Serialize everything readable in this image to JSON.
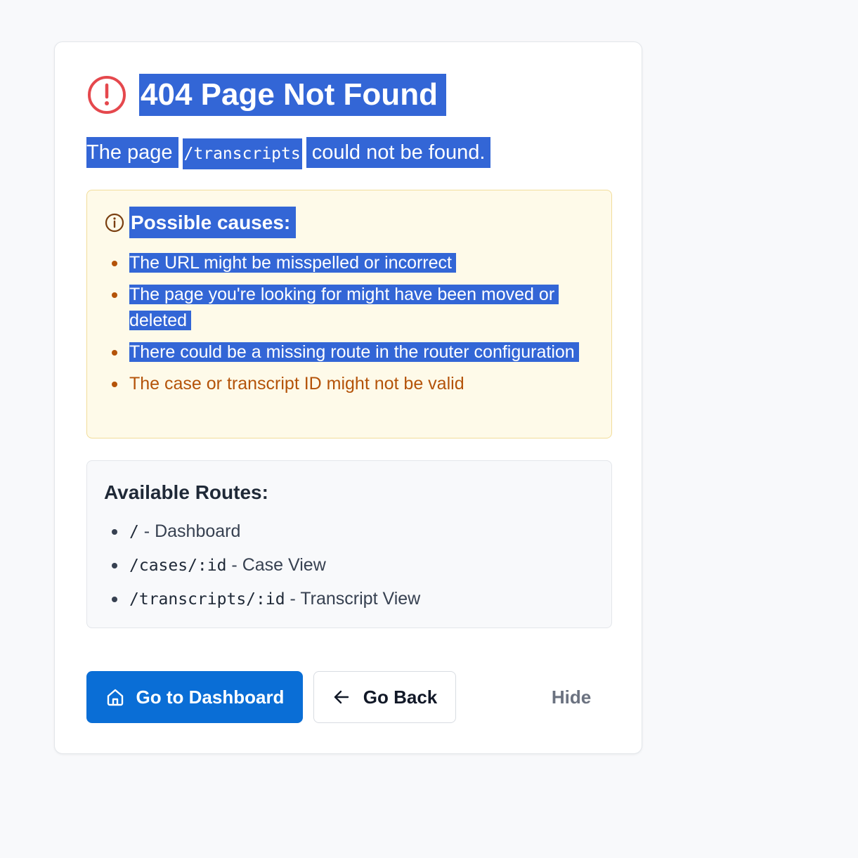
{
  "header": {
    "title": "404 Page Not Found",
    "message_prefix": "The page",
    "path": "/transcripts",
    "message_suffix": "could not be found."
  },
  "causes": {
    "title": "Possible causes:",
    "items": [
      "The URL might be misspelled or incorrect",
      "The page you're looking for might have been moved or deleted",
      "There could be a missing route in the router configuration",
      "The case or transcript ID might not be valid"
    ]
  },
  "routes": {
    "title": "Available Routes:",
    "items": [
      {
        "path": "/",
        "label": " - Dashboard"
      },
      {
        "path": "/cases/:id",
        "label": " - Case View"
      },
      {
        "path": "/transcripts/:id",
        "label": " - Transcript View"
      }
    ]
  },
  "actions": {
    "dashboard_label": "Go to Dashboard",
    "back_label": "Go Back",
    "hide_label": "Hide"
  },
  "icons": {
    "alert": "alert-circle-icon",
    "info": "info-icon",
    "home": "home-icon",
    "back": "arrow-left-icon"
  },
  "colors": {
    "error": "#e5484d",
    "primary": "#0a6ed6",
    "warning_text": "#b45309",
    "selection": "#3366d6"
  }
}
